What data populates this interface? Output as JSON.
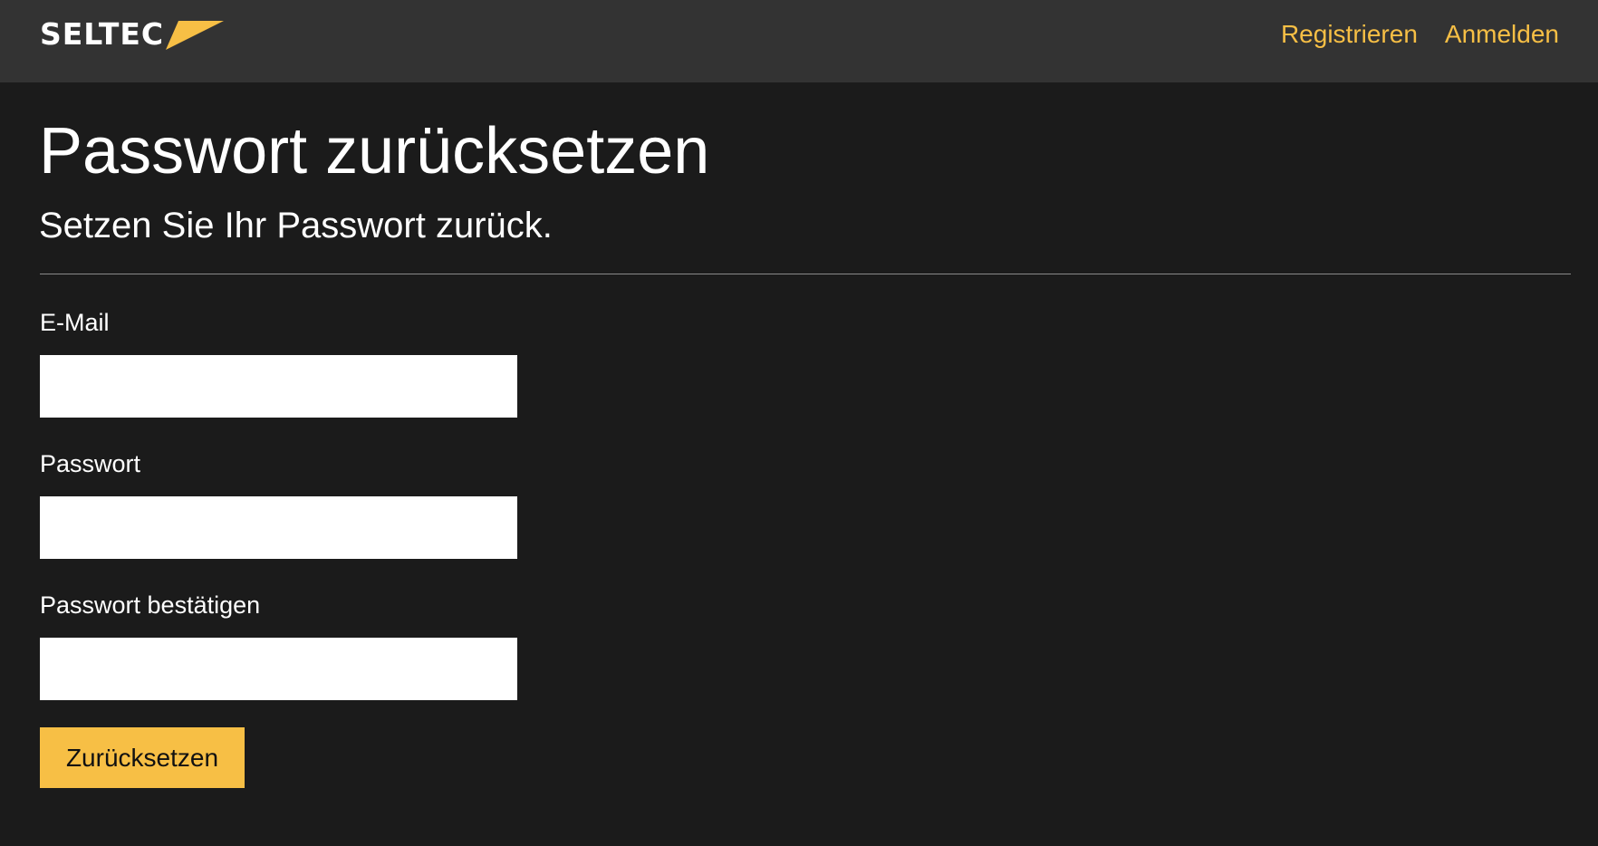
{
  "navbar": {
    "brand": "SELTEC",
    "links": [
      {
        "label": "Registrieren"
      },
      {
        "label": "Anmelden"
      }
    ],
    "colors": {
      "background": "#333333",
      "link": "#f7bf45",
      "brand_accent": "#f7bf45"
    }
  },
  "page": {
    "title": "Passwort zurücksetzen",
    "subtitle": "Setzen Sie Ihr Passwort zurück."
  },
  "form": {
    "fields": [
      {
        "label": "E-Mail",
        "value": "",
        "type": "email"
      },
      {
        "label": "Passwort",
        "value": "",
        "type": "password"
      },
      {
        "label": "Passwort bestätigen",
        "value": "",
        "type": "password"
      }
    ],
    "submit_label": "Zurücksetzen"
  },
  "colors": {
    "page_background": "#1b1b1b",
    "accent": "#f7bf45",
    "text": "#ffffff"
  }
}
